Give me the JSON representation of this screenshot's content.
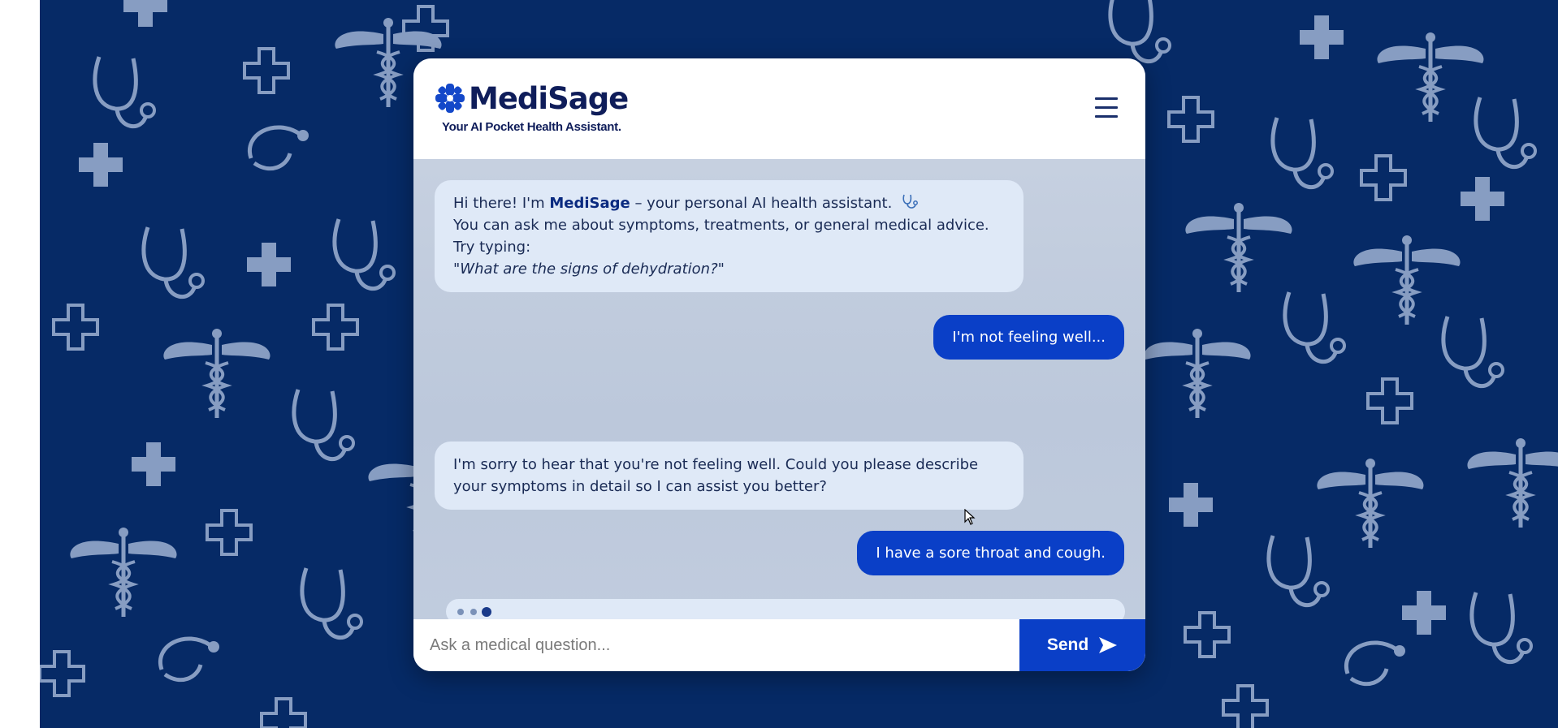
{
  "app": {
    "brand": "MediSage",
    "tagline": "Your AI Pocket Health Assistant."
  },
  "messages": [
    {
      "role": "bot",
      "intro_before": "Hi there! I'm ",
      "intro_bold": "MediSage",
      "intro_after": " – your personal AI health assistant.",
      "line2": "You can ask me about symptoms, treatments, or general medical advice. Try typing:",
      "example": "\"What are the signs of dehydration?\""
    },
    {
      "role": "user",
      "text": "I'm not feeling well..."
    },
    {
      "role": "bot",
      "text": "I'm sorry to hear that you're not feeling well. Could you please describe your symptoms in detail so I can assist you better?"
    },
    {
      "role": "user",
      "text": "I have a sore throat and cough."
    }
  ],
  "input": {
    "placeholder": "Ask a medical question...",
    "value": ""
  },
  "send_button": {
    "label": "Send"
  },
  "colors": {
    "background": "#062a66",
    "accent": "#0a3fc7",
    "bot_bubble": "#dfe9f7",
    "brand_text": "#0f1d5a"
  },
  "icons": [
    "medical-cross-logo-icon",
    "menu-icon",
    "stethoscope-icon",
    "send-arrow-icon"
  ]
}
